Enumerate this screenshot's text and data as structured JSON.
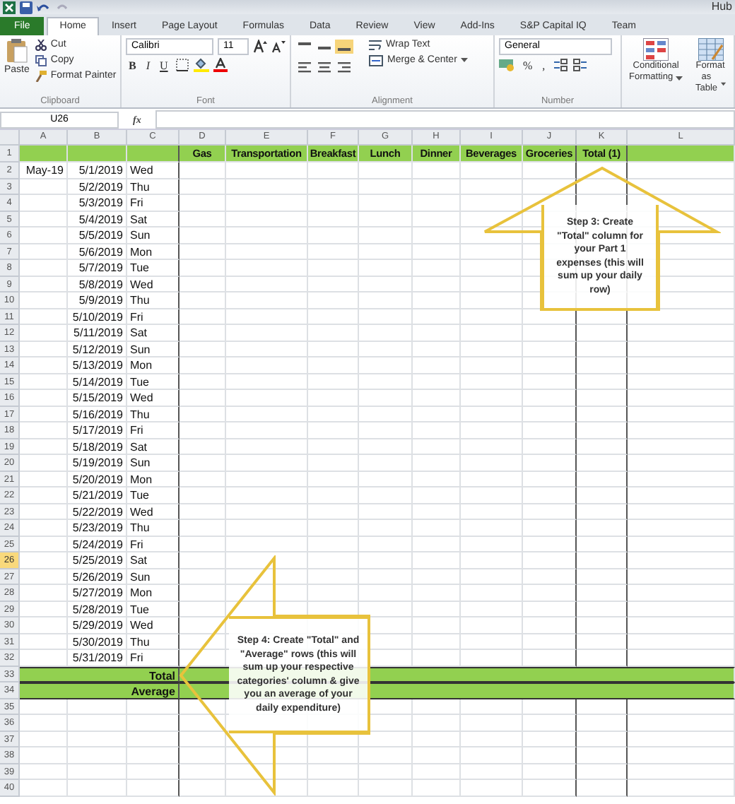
{
  "title_bar": {
    "title": "Hub"
  },
  "tabs": [
    {
      "label": "File",
      "kind": "file",
      "selected": false
    },
    {
      "label": "Home",
      "kind": "tab",
      "selected": true
    },
    {
      "label": "Insert",
      "kind": "tab",
      "selected": false
    },
    {
      "label": "Page Layout",
      "kind": "tab",
      "selected": false
    },
    {
      "label": "Formulas",
      "kind": "tab",
      "selected": false
    },
    {
      "label": "Data",
      "kind": "tab",
      "selected": false
    },
    {
      "label": "Review",
      "kind": "tab",
      "selected": false
    },
    {
      "label": "View",
      "kind": "tab",
      "selected": false
    },
    {
      "label": "Add-Ins",
      "kind": "tab",
      "selected": false
    },
    {
      "label": "S&P Capital IQ",
      "kind": "tab",
      "selected": false
    },
    {
      "label": "Team",
      "kind": "tab",
      "selected": false
    }
  ],
  "ribbon": {
    "clipboard": {
      "paste": "Paste",
      "cut": "Cut",
      "copy": "Copy",
      "format_painter": "Format Painter",
      "label": "Clipboard"
    },
    "font": {
      "name": "Calibri",
      "size": "11",
      "bold": "B",
      "italic": "I",
      "underline": "U",
      "label": "Font"
    },
    "alignment": {
      "wrap": "Wrap Text",
      "merge": "Merge & Center",
      "label": "Alignment"
    },
    "number": {
      "format": "General",
      "percent": "%",
      "comma": ",",
      "label": "Number"
    },
    "styles": {
      "conditional": [
        "Conditional",
        "Formatting"
      ],
      "format_table": [
        "Format",
        "as Table"
      ]
    }
  },
  "formula_bar": {
    "name_box": "U26",
    "fx": "fx"
  },
  "columns": [
    "A",
    "B",
    "C",
    "D",
    "E",
    "F",
    "G",
    "H",
    "I",
    "J",
    "K",
    "L"
  ],
  "rows": [
    {
      "number": "1",
      "kind": "header",
      "selected": false,
      "labels": [
        "Gas",
        "Transportation",
        "Breakfast",
        "Lunch",
        "Dinner",
        "Beverages",
        "Groceries",
        "Total (1)"
      ]
    },
    {
      "number": "2",
      "kind": "date",
      "selected": false,
      "month": "May-19",
      "date": "5/1/2019",
      "day": "Wed"
    },
    {
      "number": "3",
      "kind": "date",
      "selected": false,
      "date": "5/2/2019",
      "day": "Thu"
    },
    {
      "number": "4",
      "kind": "date",
      "selected": false,
      "date": "5/3/2019",
      "day": "Fri"
    },
    {
      "number": "5",
      "kind": "date",
      "selected": false,
      "date": "5/4/2019",
      "day": "Sat"
    },
    {
      "number": "6",
      "kind": "date",
      "selected": false,
      "date": "5/5/2019",
      "day": "Sun"
    },
    {
      "number": "7",
      "kind": "date",
      "selected": false,
      "date": "5/6/2019",
      "day": "Mon"
    },
    {
      "number": "8",
      "kind": "date",
      "selected": false,
      "date": "5/7/2019",
      "day": "Tue"
    },
    {
      "number": "9",
      "kind": "date",
      "selected": false,
      "date": "5/8/2019",
      "day": "Wed"
    },
    {
      "number": "10",
      "kind": "date",
      "selected": false,
      "date": "5/9/2019",
      "day": "Thu"
    },
    {
      "number": "11",
      "kind": "date",
      "selected": false,
      "date": "5/10/2019",
      "day": "Fri"
    },
    {
      "number": "12",
      "kind": "date",
      "selected": false,
      "date": "5/11/2019",
      "day": "Sat"
    },
    {
      "number": "13",
      "kind": "date",
      "selected": false,
      "date": "5/12/2019",
      "day": "Sun"
    },
    {
      "number": "14",
      "kind": "date",
      "selected": false,
      "date": "5/13/2019",
      "day": "Mon"
    },
    {
      "number": "15",
      "kind": "date",
      "selected": false,
      "date": "5/14/2019",
      "day": "Tue"
    },
    {
      "number": "16",
      "kind": "date",
      "selected": false,
      "date": "5/15/2019",
      "day": "Wed"
    },
    {
      "number": "17",
      "kind": "date",
      "selected": false,
      "date": "5/16/2019",
      "day": "Thu"
    },
    {
      "number": "18",
      "kind": "date",
      "selected": false,
      "date": "5/17/2019",
      "day": "Fri"
    },
    {
      "number": "19",
      "kind": "date",
      "selected": false,
      "date": "5/18/2019",
      "day": "Sat"
    },
    {
      "number": "20",
      "kind": "date",
      "selected": false,
      "date": "5/19/2019",
      "day": "Sun"
    },
    {
      "number": "21",
      "kind": "date",
      "selected": false,
      "date": "5/20/2019",
      "day": "Mon"
    },
    {
      "number": "22",
      "kind": "date",
      "selected": false,
      "date": "5/21/2019",
      "day": "Tue"
    },
    {
      "number": "23",
      "kind": "date",
      "selected": false,
      "date": "5/22/2019",
      "day": "Wed"
    },
    {
      "number": "24",
      "kind": "date",
      "selected": false,
      "date": "5/23/2019",
      "day": "Thu"
    },
    {
      "number": "25",
      "kind": "date",
      "selected": false,
      "date": "5/24/2019",
      "day": "Fri"
    },
    {
      "number": "26",
      "kind": "date",
      "selected": true,
      "date": "5/25/2019",
      "day": "Sat"
    },
    {
      "number": "27",
      "kind": "date",
      "selected": false,
      "date": "5/26/2019",
      "day": "Sun"
    },
    {
      "number": "28",
      "kind": "date",
      "selected": false,
      "date": "5/27/2019",
      "day": "Mon"
    },
    {
      "number": "29",
      "kind": "date",
      "selected": false,
      "date": "5/28/2019",
      "day": "Tue"
    },
    {
      "number": "30",
      "kind": "date",
      "selected": false,
      "date": "5/29/2019",
      "day": "Wed"
    },
    {
      "number": "31",
      "kind": "date",
      "selected": false,
      "date": "5/30/2019",
      "day": "Thu"
    },
    {
      "number": "32",
      "kind": "date",
      "selected": false,
      "date": "5/31/2019",
      "day": "Fri"
    },
    {
      "number": "33",
      "kind": "summary",
      "selected": false,
      "label": "Total"
    },
    {
      "number": "34",
      "kind": "summary",
      "selected": false,
      "label": "Average"
    },
    {
      "number": "35",
      "kind": "empty",
      "selected": false
    },
    {
      "number": "36",
      "kind": "empty",
      "selected": false
    },
    {
      "number": "37",
      "kind": "empty",
      "selected": false
    },
    {
      "number": "38",
      "kind": "empty",
      "selected": false
    },
    {
      "number": "39",
      "kind": "empty",
      "selected": false
    },
    {
      "number": "40",
      "kind": "empty",
      "selected": false
    }
  ],
  "callouts": [
    {
      "kind": "up",
      "text": "Step 3: Create \"Total\" column for your Part 1 expenses (this will sum up your daily row)"
    },
    {
      "kind": "left",
      "text": "Step 4: Create \"Total\" and \"Average\" rows (this will sum up your respective categories' column & give you an average of your daily expenditure)"
    }
  ]
}
